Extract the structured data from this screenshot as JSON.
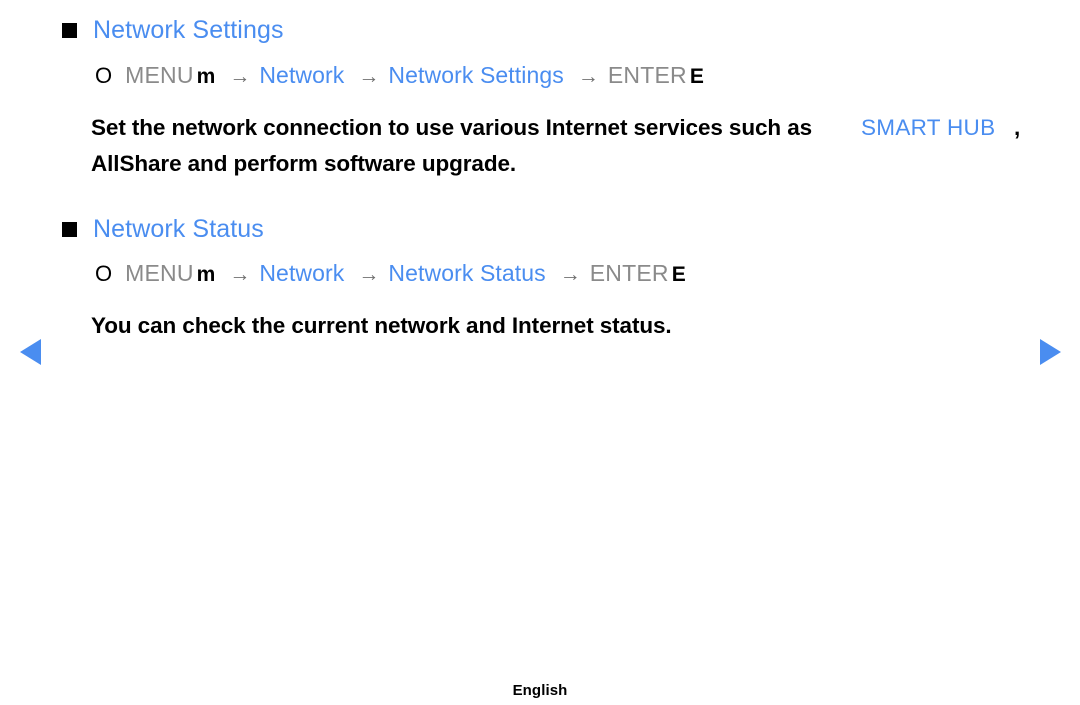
{
  "page": {
    "language_footer": "English",
    "accent_blue": "#4a8df0",
    "key_gray": "#8a8a8a",
    "text_black": "#000000",
    "background": "#ffffff"
  },
  "nav": {
    "prev_label": "◀",
    "next_label": "▶"
  },
  "sections": [
    {
      "heading": "Network Settings",
      "path": {
        "ring": "O",
        "menu_word": "MENU",
        "menu_key": "m",
        "arrow": "→",
        "step1": "Network",
        "step2": "Network Settings",
        "enter_word": "ENTER",
        "enter_key": "E"
      },
      "body": {
        "line1_black": "Set the network connection to use various Internet services such as",
        "line1_overlap_blue": "SMART HUB",
        "line1_comma": ",",
        "line2_black": "AllShare and perform software upgrade."
      }
    },
    {
      "heading": "Network Status",
      "path": {
        "ring": "O",
        "menu_word": "MENU",
        "menu_key": "m",
        "arrow": "→",
        "step1": "Network",
        "step2": "Network Status",
        "enter_word": "ENTER",
        "enter_key": "E"
      },
      "body": {
        "line1_black": "You can check the current network and Internet status."
      }
    }
  ]
}
